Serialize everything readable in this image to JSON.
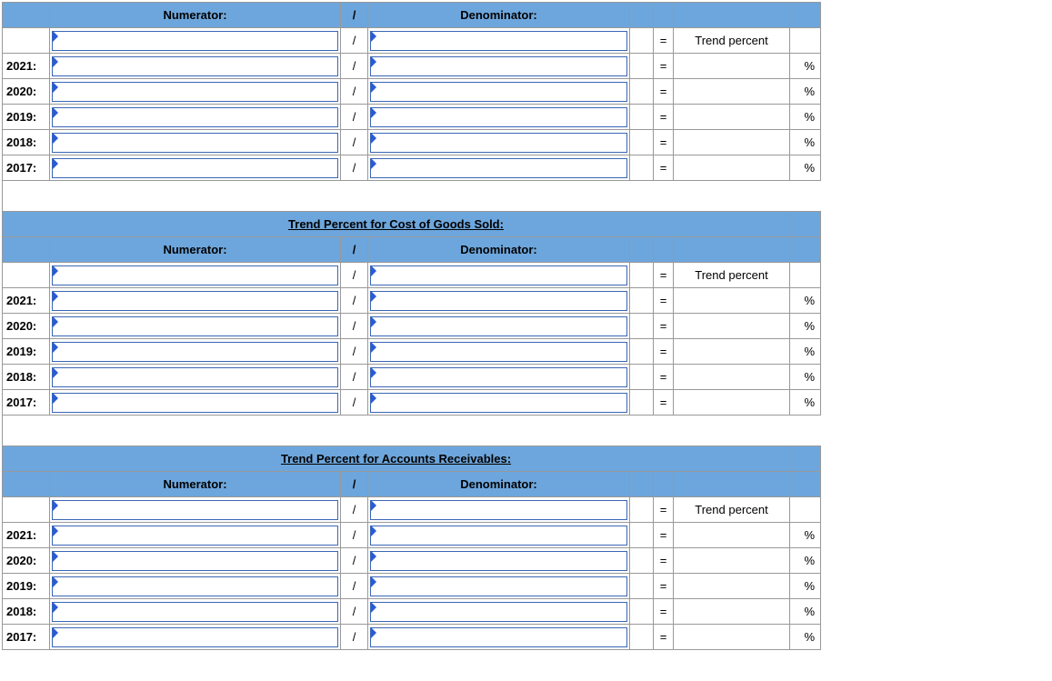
{
  "common": {
    "numerator_label": "Numerator:",
    "denominator_label": "Denominator:",
    "slash": "/",
    "equals": "=",
    "result_label": "Trend percent",
    "percent": "%",
    "years": [
      "2021:",
      "2020:",
      "2019:",
      "2018:",
      "2017:"
    ]
  },
  "sections": [
    {
      "title": ""
    },
    {
      "title": "Trend Percent for Cost of Goods Sold:"
    },
    {
      "title": "Trend Percent for Accounts Receivables:"
    }
  ]
}
